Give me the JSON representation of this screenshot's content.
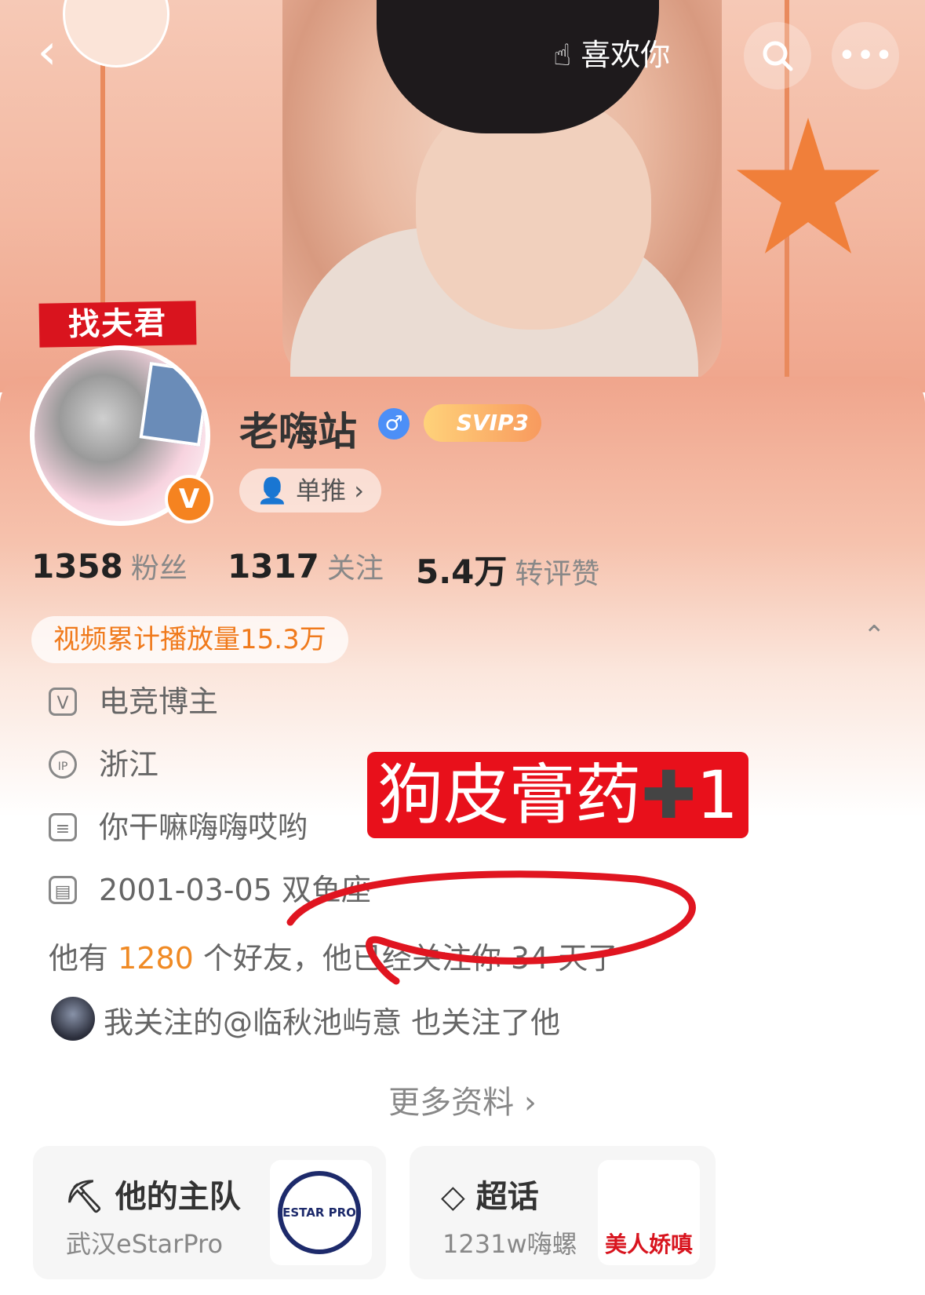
{
  "header": {
    "back_icon": "‹",
    "like_label": "喜欢你",
    "like_icon": "hand-heart-icon",
    "search_icon": "search-icon",
    "more_icon": "more-icon"
  },
  "banner": {
    "sticker_text": "找夫君"
  },
  "profile": {
    "username": "老嗨站",
    "verified_badge": "V",
    "gender_symbol": "♂",
    "vip_label": "SVIP3",
    "tag_label": "单推 ›",
    "stats": [
      {
        "value": "1358",
        "label": "粉丝"
      },
      {
        "value": "1317",
        "label": "关注"
      },
      {
        "value": "5.4万",
        "label": "转评赞"
      }
    ],
    "video_plays": "视频累计播放量15.3万",
    "collapse_icon": "⌃",
    "info": [
      {
        "icon": "V",
        "text": "电竞博主"
      },
      {
        "icon": "IP",
        "text": "浙江"
      },
      {
        "icon": "≡",
        "text": "你干嘛嗨嗨哎哟"
      },
      {
        "icon": "▤",
        "text": "2001-03-05 双鱼座"
      }
    ],
    "friends_prefix": "他有 ",
    "friends_count": "1280",
    "friends_suffix": " 个好友，他已经关注你 34 天了",
    "mutual_text": "我关注的@临秋池屿意 也关注了他",
    "more_label": "更多资料 ›"
  },
  "overlay": {
    "text": "狗皮膏药",
    "plus": "✚",
    "one": "1"
  },
  "cards": [
    {
      "title": "他的主队",
      "subtitle": "武汉eStarPro",
      "icon": "team-icon",
      "logo_text": "ESTAR PRO"
    },
    {
      "title": "超话",
      "subtitle": "1231w嗨螺",
      "icon": "diamond-icon",
      "image_caption": "美人娇嗔"
    }
  ],
  "colors": {
    "accent": "#f07a1c",
    "overlay_red": "#e8101b",
    "gender_blue": "#4c8ff7",
    "verified_orange": "#f58320"
  }
}
